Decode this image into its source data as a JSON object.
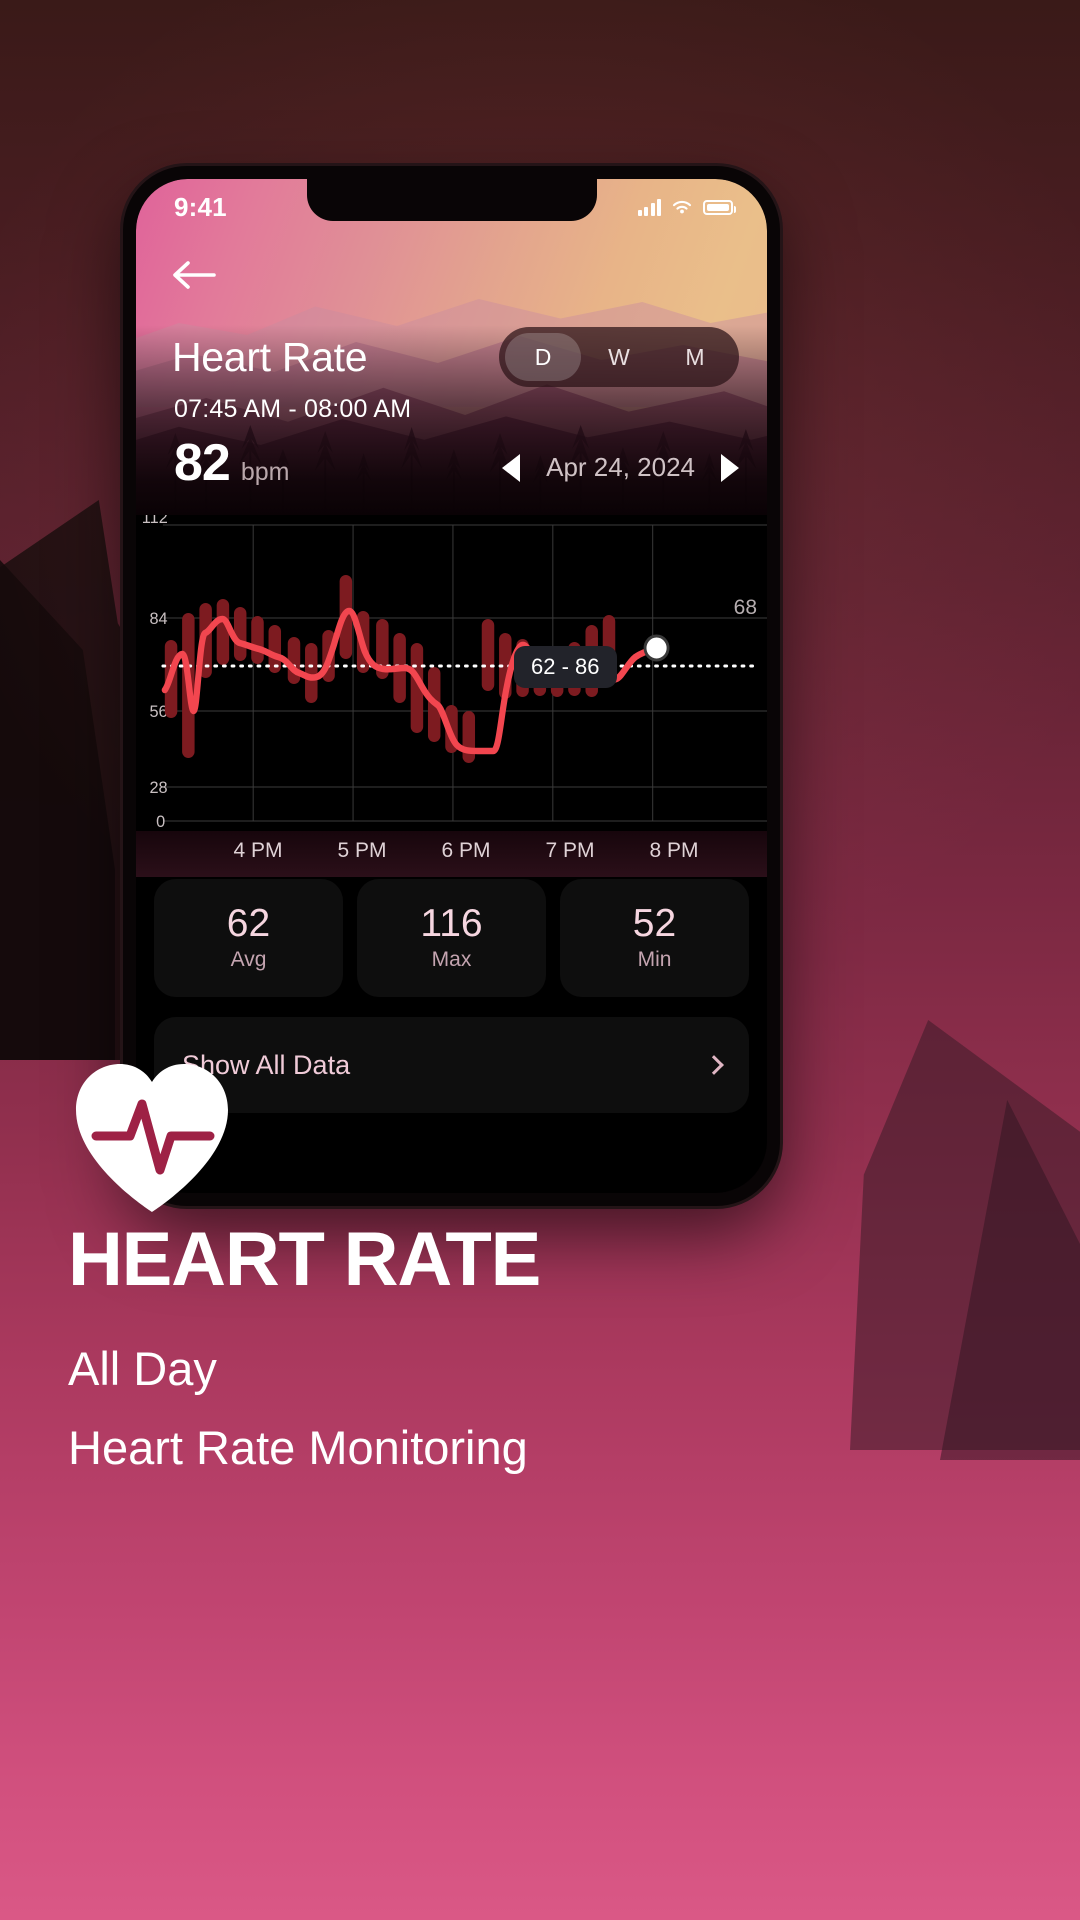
{
  "status_bar": {
    "time": "9:41",
    "cellular_icon": "signal-bars-icon",
    "wifi_icon": "wifi-icon",
    "battery_icon": "battery-icon"
  },
  "header": {
    "back_icon": "back-arrow-icon",
    "title": "Heart Rate",
    "time_range": "07:45 AM - 08:00 AM",
    "segments": [
      {
        "label": "D",
        "active": true
      },
      {
        "label": "W",
        "active": false
      },
      {
        "label": "M",
        "active": false
      }
    ]
  },
  "reading": {
    "value": "82",
    "unit": "bpm"
  },
  "date_nav": {
    "prev_icon": "left-triangle-icon",
    "date": "Apr 24, 2024",
    "next_icon": "right-triangle-icon"
  },
  "chart_data": {
    "type": "line",
    "title": "Heart Rate",
    "xlabel": "",
    "ylabel": "bpm",
    "ylim": [
      0,
      120
    ],
    "yticks": [
      0,
      28,
      56,
      84,
      112
    ],
    "ytick_labels": [
      "0",
      "28",
      "56",
      "84",
      "112"
    ],
    "xticks": [
      "4 PM",
      "5 PM",
      "6 PM",
      "7 PM",
      "8 PM"
    ],
    "grid": true,
    "legend": "none",
    "threshold_line": {
      "value": 68,
      "label": "68",
      "style": "dotted",
      "color": "#ffffff"
    },
    "selected_point": {
      "label": "62 - 86",
      "min": 62,
      "max": 86,
      "marker": "white-dot"
    },
    "line_color": "#f2464f",
    "band_color": "#7a1a1e",
    "x": [
      "15:45",
      "16:00",
      "16:10",
      "16:20",
      "16:30",
      "16:40",
      "16:50",
      "17:00",
      "17:10",
      "17:20",
      "17:30",
      "17:40",
      "17:50",
      "18:00",
      "18:10",
      "18:20",
      "18:30",
      "18:40",
      "18:50",
      "19:00",
      "19:10",
      "19:20",
      "19:30",
      "19:40",
      "19:50",
      "20:00",
      "20:10",
      "20:15"
    ],
    "series": [
      {
        "name": "Heart Rate (avg)",
        "values": [
          60,
          78,
          79,
          84,
          83,
          80,
          78,
          76,
          72,
          69,
          67,
          66,
          71,
          92,
          84,
          71,
          69,
          66,
          58,
          50,
          50,
          50,
          82,
          76,
          70,
          69,
          70,
          74
        ]
      },
      {
        "name": "Heart Rate (range low)",
        "values": [
          52,
          44,
          52,
          62,
          62,
          60,
          62,
          58,
          55,
          52,
          50,
          50,
          56,
          64,
          62,
          56,
          48,
          42,
          42,
          40,
          40,
          40,
          58,
          56,
          58,
          58,
          60,
          62
        ]
      },
      {
        "name": "Heart Rate (range high)",
        "values": [
          72,
          86,
          88,
          92,
          90,
          84,
          84,
          78,
          76,
          72,
          70,
          70,
          82,
          104,
          92,
          86,
          80,
          76,
          68,
          58,
          58,
          58,
          90,
          84,
          78,
          76,
          80,
          86
        ]
      }
    ]
  },
  "stats": [
    {
      "value": "62",
      "label": "Avg"
    },
    {
      "value": "116",
      "label": "Max"
    },
    {
      "value": "52",
      "label": "Min"
    }
  ],
  "show_all": {
    "label": "Show All Data",
    "chevron_icon": "chevron-right-icon"
  },
  "marketing": {
    "badge_icon": "heart-pulse-icon",
    "headline": "HEART RATE",
    "subtitle_line1": "All Day",
    "subtitle_line2": "Heart Rate Monitoring"
  },
  "colors": {
    "accent_red": "#f2464f",
    "band_dark_red": "#7a1a1e",
    "brand_pink": "#da5886",
    "stat_text": "#f6d6e0"
  }
}
